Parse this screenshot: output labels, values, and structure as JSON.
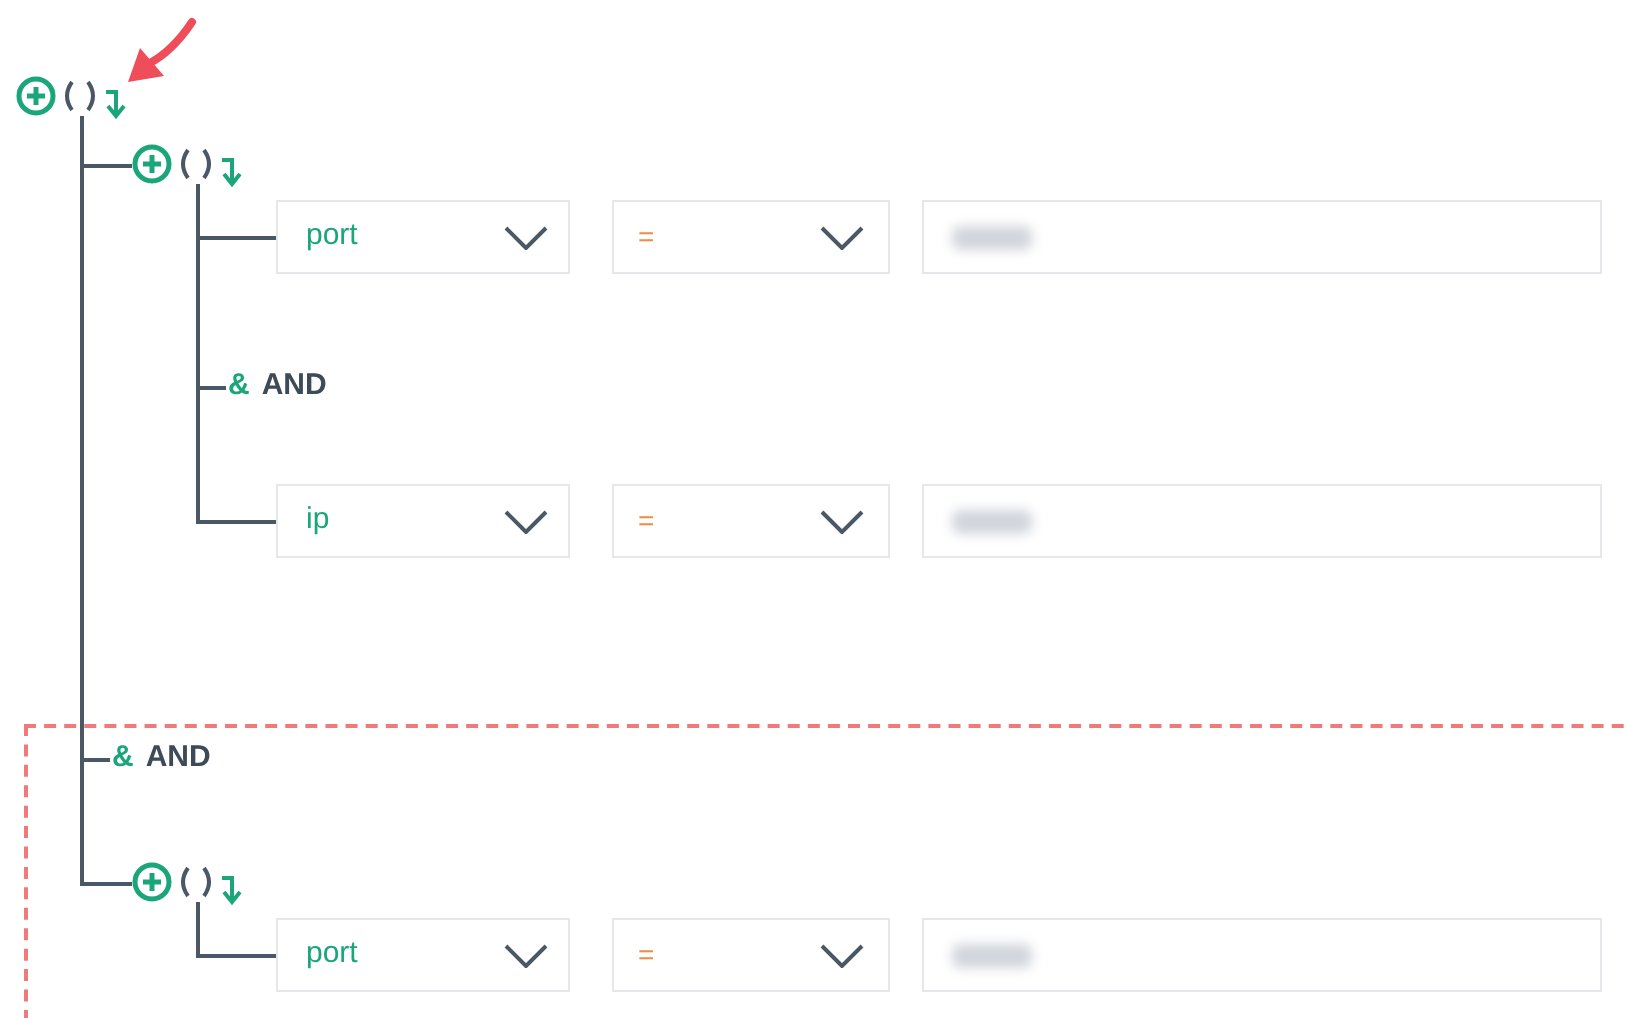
{
  "root": {
    "kind": "group",
    "children": [
      {
        "kind": "group",
        "children": [
          {
            "kind": "condition",
            "field": "port",
            "operator": "="
          },
          {
            "kind": "and",
            "symbol": "&",
            "label": "AND"
          },
          {
            "kind": "condition",
            "field": "ip",
            "operator": "="
          }
        ]
      },
      {
        "kind": "and",
        "symbol": "&",
        "label": "AND"
      },
      {
        "kind": "group",
        "children": [
          {
            "kind": "condition",
            "field": "port",
            "operator": "="
          }
        ]
      }
    ]
  }
}
